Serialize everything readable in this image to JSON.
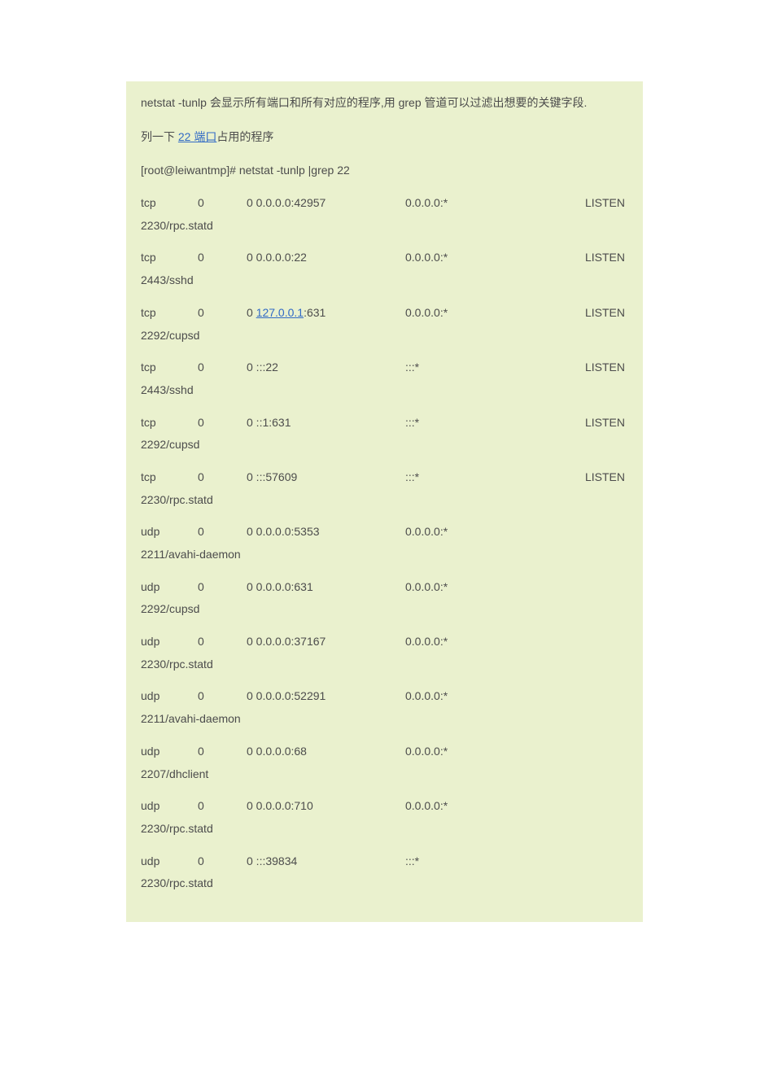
{
  "intro": "netstat -tunlp 会显示所有端口和所有对应的程序,用 grep 管道可以过滤出想要的关键字段.",
  "sub_intro_prefix": "列一下 ",
  "sub_intro_link": "22 端口",
  "sub_intro_suffix": "占用的程序",
  "command": "[root@leiwantmp]# netstat -tunlp |grep 22",
  "rows": [
    {
      "proto": "tcp",
      "recv": "0",
      "send_local": "0  0.0.0.0:42957",
      "foreign": "0.0.0.0:*",
      "state": "LISTEN",
      "program": "2230/rpc.statd",
      "link": false
    },
    {
      "proto": "tcp",
      "recv": "0",
      "send_local": "0  0.0.0.0:22",
      "foreign": "0.0.0.0:*",
      "state": "LISTEN",
      "program": "2443/sshd",
      "link": false
    },
    {
      "proto": "tcp",
      "recv": "0",
      "send_local_prefix": "0  ",
      "send_local_link": "127.0.0.1",
      "send_local_suffix": ":631",
      "foreign": "0.0.0.0:*",
      "state": "LISTEN",
      "program": "2292/cupsd",
      "link": true
    },
    {
      "proto": "tcp",
      "recv": "0",
      "send_local": "0  :::22",
      "foreign": ":::*",
      "state": "LISTEN",
      "program": "2443/sshd",
      "link": false
    },
    {
      "proto": "tcp",
      "recv": "0",
      "send_local": "0  ::1:631",
      "foreign": ":::*",
      "state": "LISTEN",
      "program": "2292/cupsd",
      "link": false
    },
    {
      "proto": "tcp",
      "recv": "0",
      "send_local": "0  :::57609",
      "foreign": ":::*",
      "state": "LISTEN",
      "program": "2230/rpc.statd",
      "link": false
    },
    {
      "proto": "udp",
      "recv": "0",
      "send_local": "0  0.0.0.0:5353",
      "foreign": "0.0.0.0:*",
      "state": "",
      "program": "2211/avahi-daemon",
      "link": false
    },
    {
      "proto": "udp",
      "recv": "0",
      "send_local": "0  0.0.0.0:631",
      "foreign": "0.0.0.0:*",
      "state": "",
      "program": "2292/cupsd",
      "link": false
    },
    {
      "proto": "udp",
      "recv": "0",
      "send_local": "0  0.0.0.0:37167",
      "foreign": "0.0.0.0:*",
      "state": "",
      "program": "2230/rpc.statd",
      "link": false
    },
    {
      "proto": "udp",
      "recv": "0",
      "send_local": "0  0.0.0.0:52291",
      "foreign": "0.0.0.0:*",
      "state": "",
      "program": "2211/avahi-daemon",
      "link": false
    },
    {
      "proto": "udp",
      "recv": "0",
      "send_local": "0  0.0.0.0:68",
      "foreign": "0.0.0.0:*",
      "state": "",
      "program": "2207/dhclient",
      "link": false
    },
    {
      "proto": "udp",
      "recv": "0",
      "send_local": "0  0.0.0.0:710",
      "foreign": "0.0.0.0:*",
      "state": "",
      "program": "2230/rpc.statd",
      "link": false
    },
    {
      "proto": "udp",
      "recv": "0",
      "send_local": "0  :::39834",
      "foreign": ":::*",
      "state": "",
      "program": "2230/rpc.statd",
      "link": false
    }
  ]
}
